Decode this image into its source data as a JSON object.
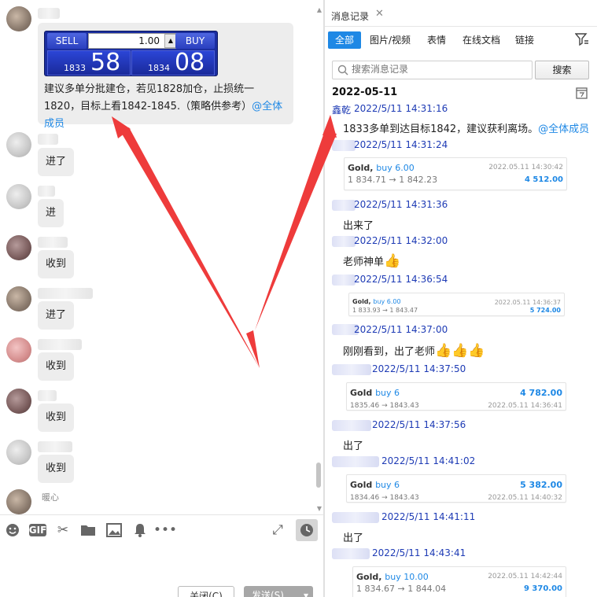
{
  "chat": {
    "trade_widget": {
      "sell_label": "SELL",
      "buy_label": "BUY",
      "quantity": "1.00",
      "spin_down": "▼",
      "spin_up": "▲",
      "sell_small": "1833",
      "sell_large": "58",
      "buy_small": "1834",
      "buy_large": "08"
    },
    "big_message_text": "建议多单分批建仓，若见1828加仓，止损统一1820，目标上看1842-1845.（策略供参考）",
    "big_message_mention": "@全体成员",
    "messages": [
      "进了",
      "进",
      "收到",
      "进了",
      "收到",
      "收到",
      "收到"
    ],
    "last_sender": "暖心"
  },
  "toolbar": {
    "gif_label": "GIF",
    "close_label": "关闭(C)",
    "send_label": "发送(S)",
    "send_arrow": "▾"
  },
  "history": {
    "tab_title": "消息记录",
    "filters": [
      "全部",
      "图片/视频",
      "表情",
      "在线文档",
      "链接"
    ],
    "search_placeholder": "搜索消息记录",
    "search_button": "搜索",
    "date_heading": "2022-05-11",
    "first_sender": "鑫乾",
    "entries": [
      {
        "time": "2022/5/11 14:31:16",
        "text": "1833多单到达目标1842，建议获利离场。",
        "mention": "@全体成员"
      },
      {
        "time": "2022/5/11 14:31:24",
        "card": {
          "symbol": "Gold,",
          "side": "buy 6.00",
          "date": "2022.05.11 14:30:42",
          "prices": "1 834.71 → 1 842.23",
          "amount": "4 512.00"
        }
      },
      {
        "time": "2022/5/11 14:31:36",
        "text": "出来了"
      },
      {
        "time": "2022/5/11 14:32:00",
        "text": "老师神单",
        "emoji": "👍"
      },
      {
        "time": "2022/5/11 14:36:54",
        "card": {
          "symbol": "Gold,",
          "side": "buy 6.00",
          "date": "2022.05.11 14:36:37",
          "prices": "1 833.93 → 1 843.47",
          "amount": "5 724.00"
        }
      },
      {
        "time": "2022/5/11 14:37:00",
        "text": "刚刚看到，出了老师",
        "emoji": "👍👍👍"
      },
      {
        "time": "2022/5/11 14:37:50",
        "card": {
          "symbol": "Gold",
          "side": "buy 6",
          "date": "2022.05.11 14:36:41",
          "prices": "1835.46 → 1843.43",
          "amount": "4 782.00"
        }
      },
      {
        "time": "2022/5/11 14:37:56",
        "text": "出了"
      },
      {
        "time": "2022/5/11 14:41:02",
        "card": {
          "symbol": "Gold",
          "side": "buy 6",
          "date": "2022.05.11 14:40:32",
          "prices": "1834.46 → 1843.43",
          "amount": "5 382.00"
        }
      },
      {
        "time": "2022/5/11 14:41:11",
        "text": "出了"
      },
      {
        "time": "2022/5/11 14:43:41",
        "card": {
          "symbol": "Gold,",
          "side": "buy 10.00",
          "date": "2022.05.11 14:42:44",
          "prices": "1 834.67 → 1 844.04",
          "amount": "9 370.00"
        }
      }
    ]
  },
  "colors": {
    "accent": "#1e88e5",
    "arrow": "#ee3b3b",
    "widget": "#1b2ea0"
  },
  "icons": [
    "emoji-icon",
    "gif-icon",
    "scissors-icon",
    "folder-icon",
    "image-icon",
    "bell-icon",
    "more-icon",
    "expand-icon",
    "clock-icon",
    "search-icon",
    "filter-icon",
    "calendar-icon",
    "close-icon"
  ]
}
